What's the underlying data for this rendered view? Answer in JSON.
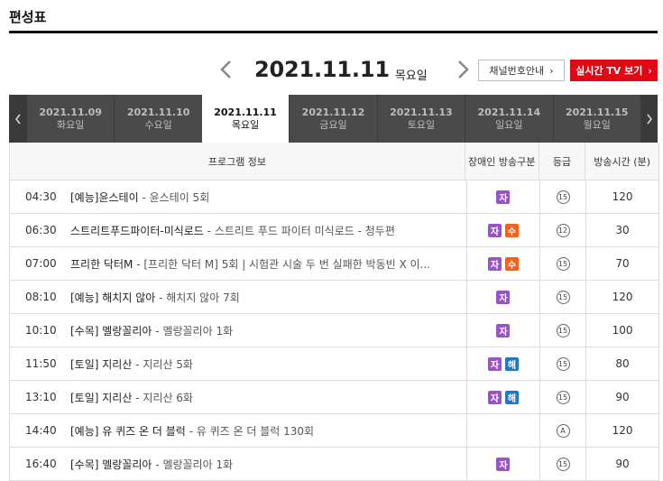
{
  "page_title": "편성표",
  "nav": {
    "current_date": "2021.11.11",
    "current_day": "목요일",
    "channel_guide_label": "채널번호안내",
    "live_tv_label": "실시간 TV 보기"
  },
  "day_tabs": [
    {
      "date": "2021.11.09",
      "day": "화요일",
      "active": false
    },
    {
      "date": "2021.11.10",
      "day": "수요일",
      "active": false
    },
    {
      "date": "2021.11.11",
      "day": "목요일",
      "active": true
    },
    {
      "date": "2021.11.12",
      "day": "금요일",
      "active": false
    },
    {
      "date": "2021.11.13",
      "day": "토요일",
      "active": false
    },
    {
      "date": "2021.11.14",
      "day": "일요일",
      "active": false
    },
    {
      "date": "2021.11.15",
      "day": "월요일",
      "active": false
    }
  ],
  "table": {
    "headers": {
      "program": "프로그램 정보",
      "accessibility": "장애인 방송구분",
      "grade": "등급",
      "duration": "방송시간 (분)"
    },
    "rows": [
      {
        "time": "04:30",
        "title": "[예능]윤스테이",
        "episode": "윤스테이 5회",
        "badges": [
          "자"
        ],
        "grade": "15",
        "duration": "120"
      },
      {
        "time": "06:30",
        "title": "스트리트푸드파이터-미식로드",
        "episode": "스트리트 푸드 파이터 미식로드 - 청두편",
        "badges": [
          "자",
          "수"
        ],
        "grade": "12",
        "duration": "30"
      },
      {
        "time": "07:00",
        "title": "프리한 닥터M",
        "episode": "[프리한 닥터 M] 5회 | 시험관 시술 두 번 실패한 박동빈 X 이...",
        "badges": [
          "자",
          "수"
        ],
        "grade": "15",
        "duration": "70"
      },
      {
        "time": "08:10",
        "title": "[예능] 해치지 않아",
        "episode": "해치지 않아 7회",
        "badges": [
          "자"
        ],
        "grade": "15",
        "duration": "120"
      },
      {
        "time": "10:10",
        "title": "[수목] 멜랑꼴리아",
        "episode": "멜랑꼴리아 1화",
        "badges": [
          "자"
        ],
        "grade": "15",
        "duration": "100"
      },
      {
        "time": "11:50",
        "title": "[토일] 지리산",
        "episode": "지리산 5화",
        "badges": [
          "자",
          "해"
        ],
        "grade": "15",
        "duration": "80"
      },
      {
        "time": "13:10",
        "title": "[토일] 지리산",
        "episode": "지리산 6화",
        "badges": [
          "자",
          "해"
        ],
        "grade": "15",
        "duration": "90"
      },
      {
        "time": "14:40",
        "title": "[예능] 유 퀴즈 온 더 블럭",
        "episode": "유 퀴즈 온 더 블럭 130회",
        "badges": [],
        "grade": "A",
        "duration": "120"
      },
      {
        "time": "16:40",
        "title": "[수목] 멜랑꼴리아",
        "episode": "멜랑꼴리아 1화",
        "badges": [
          "자"
        ],
        "grade": "15",
        "duration": "90"
      }
    ]
  },
  "badge_colors": {
    "자": "#9b51c9",
    "수": "#f2611d",
    "해": "#1f78c8"
  },
  "accent_color": "#e30613",
  "icons": {
    "prev": "chevron-left-icon",
    "next": "chevron-right-icon",
    "tab_prev": "tab-chevron-left-icon",
    "tab_next": "tab-chevron-right-icon",
    "button_chevron": "chevron-right-icon"
  }
}
